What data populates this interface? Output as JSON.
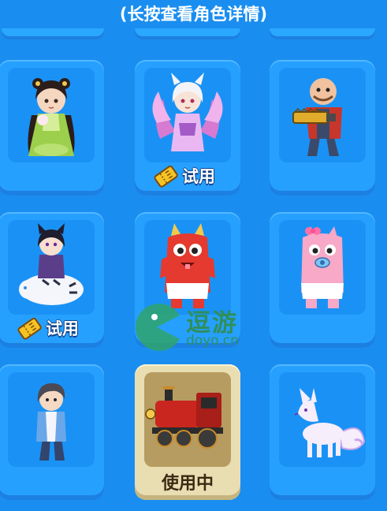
{
  "header": {
    "hint": "(长按查看角色详情)"
  },
  "cards": [
    {
      "id": "girl-hanfu",
      "tag": ""
    },
    {
      "id": "fox-spirit",
      "tag": "试用"
    },
    {
      "id": "chainsaw-man",
      "tag": ""
    },
    {
      "id": "cat-girl-tiger",
      "tag": "试用"
    },
    {
      "id": "red-monster",
      "tag": ""
    },
    {
      "id": "pink-pig-monster",
      "tag": ""
    },
    {
      "id": "boy-casual",
      "tag": ""
    },
    {
      "id": "steam-train",
      "tag": "使用中"
    },
    {
      "id": "white-fox",
      "tag": ""
    }
  ],
  "labels": {
    "trial": "试用",
    "in_use": "使用中"
  },
  "watermark": {
    "name": "逗游",
    "domain": "doyo.cn"
  },
  "colors": {
    "background": "#1a8ef0",
    "card": "#26a0ff",
    "card_selected": "#e9ddb2",
    "watermark": "#2f8f5e"
  }
}
